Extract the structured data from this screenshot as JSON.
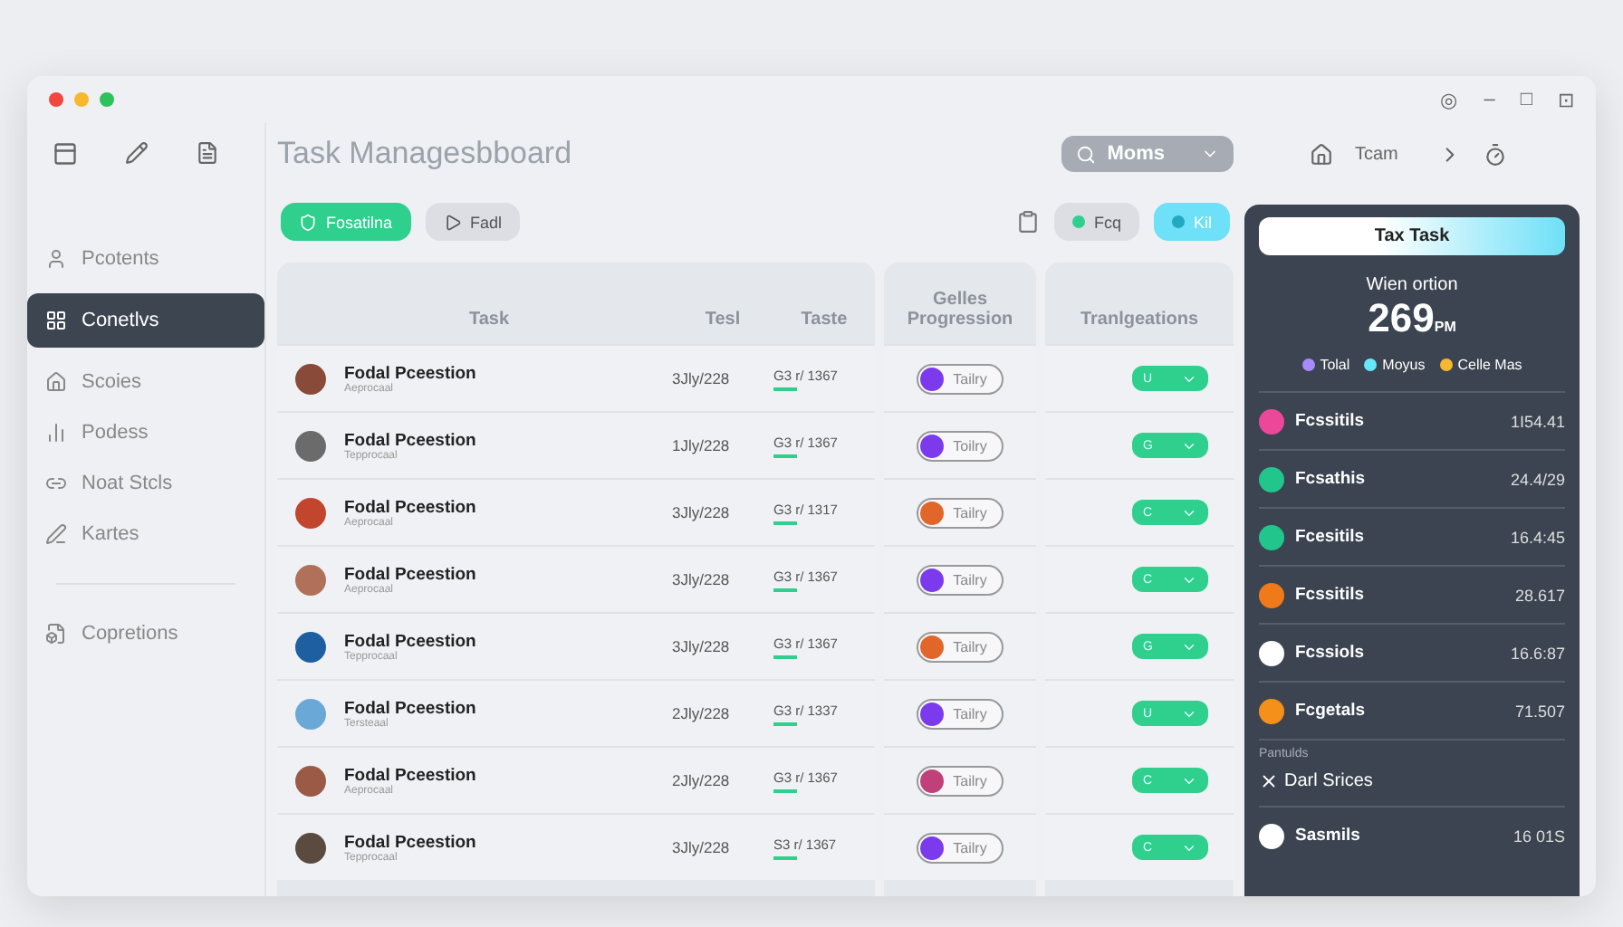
{
  "window": {
    "controls": [
      "◎",
      "–",
      "□",
      "⊡"
    ]
  },
  "sidebar": {
    "items": [
      {
        "label": "Pcotents",
        "selected": false
      },
      {
        "label": "Conetlvs",
        "selected": true
      },
      {
        "label": "Scoies",
        "selected": false
      },
      {
        "label": "Podess",
        "selected": false
      },
      {
        "label": "Noat Stcls",
        "selected": false
      },
      {
        "label": "Kartes",
        "selected": false
      }
    ],
    "footer_items": [
      {
        "label": "Copretions",
        "selected": false
      }
    ]
  },
  "header": {
    "title": "Task Managesbboard",
    "menu": "Moms",
    "nav": "Tcam"
  },
  "toolbar": {
    "left": [
      {
        "label": "Fosatilna",
        "kind": "primary"
      },
      {
        "label": "Fadl",
        "kind": "secondary"
      }
    ],
    "right": [
      {
        "label": "Fcq",
        "kind": "secondary"
      },
      {
        "label": "Kil",
        "kind": "accent"
      }
    ]
  },
  "table": {
    "columns": [
      "Task",
      "Tesl",
      "Taste",
      "Gelles Progression",
      "Tranlgeations"
    ],
    "rows": [
      {
        "name": "Fodal Pceestion",
        "sub": "Aeprocaal",
        "date": "3Jly/228",
        "time": "G3 r/ 1367",
        "pill": {
          "label": "Tailry",
          "color": "#7c3aed"
        },
        "status": "U",
        "color": "#8a4a3a"
      },
      {
        "name": "Fodal Pceestion",
        "sub": "Tepprocaal",
        "date": "1Jly/228",
        "time": "G3 r/ 1367",
        "pill": {
          "label": "Toilry",
          "color": "#7c3aed"
        },
        "status": "G",
        "color": "#6b6b6b"
      },
      {
        "name": "Fodal Pceestion",
        "sub": "Aeprocaal",
        "date": "3Jly/228",
        "time": "G3 r/ 1317",
        "pill": {
          "label": "Tailry",
          "color": "#e0662a"
        },
        "status": "C",
        "color": "#c2452d"
      },
      {
        "name": "Fodal Pceestion",
        "sub": "Aeprocaal",
        "date": "3Jly/228",
        "time": "G3 r/ 1367",
        "pill": {
          "label": "Tailry",
          "color": "#7c3aed"
        },
        "status": "C",
        "color": "#b0705a"
      },
      {
        "name": "Fodal Pceestion",
        "sub": "Tepprocaal",
        "date": "3Jly/228",
        "time": "G3 r/ 1367",
        "pill": {
          "label": "Tailry",
          "color": "#e0662a"
        },
        "status": "G",
        "color": "#1d5fa0"
      },
      {
        "name": "Fodal Pceestion",
        "sub": "Tersteaal",
        "date": "2Jly/228",
        "time": "G3 r/ 1337",
        "pill": {
          "label": "Tailry",
          "color": "#7c3aed"
        },
        "status": "U",
        "color": "#6aa8d8"
      },
      {
        "name": "Fodal Pceestion",
        "sub": "Aeprocaal",
        "date": "2Jly/228",
        "time": "G3 r/ 1367",
        "pill": {
          "label": "Tailry",
          "color": "#c0407a"
        },
        "status": "C",
        "color": "#9a5a46"
      },
      {
        "name": "Fodal Pceestion",
        "sub": "Tepprocaal",
        "date": "3Jly/228",
        "time": "S3 r/ 1367",
        "pill": {
          "label": "Tailry",
          "color": "#7c3aed"
        },
        "status": "C",
        "color": "#5a4a40"
      }
    ]
  },
  "panel": {
    "button": "Tax Task",
    "caption": "Wien ortion",
    "value": "269",
    "unit": "PM",
    "legend": [
      {
        "label": "Tolal",
        "color": "#a78bfa"
      },
      {
        "label": "Moyus",
        "color": "#67e8f9"
      },
      {
        "label": "Celle Mas",
        "color": "#f5b82e"
      }
    ],
    "items": [
      {
        "label": "Fcssitils",
        "value": "1I54.41",
        "color": "#ec4899"
      },
      {
        "label": "Fcsathis",
        "value": "24.4/29",
        "color": "#22c58b"
      },
      {
        "label": "Fcesitils",
        "value": "16.4:45",
        "color": "#22c58b"
      },
      {
        "label": "Fcssitils",
        "value": "28.617",
        "color": "#f07a1a"
      },
      {
        "label": "Fcssiols",
        "value": "16.6:87",
        "color": "#ffffff"
      },
      {
        "label": "Fcgetals",
        "value": "71.507",
        "color": "#f5901a"
      }
    ],
    "section": "Pantulds",
    "close_item": "Darl Srices",
    "last": {
      "label": "Sasmils",
      "value": "16 01S",
      "color": "#ffffff"
    }
  }
}
